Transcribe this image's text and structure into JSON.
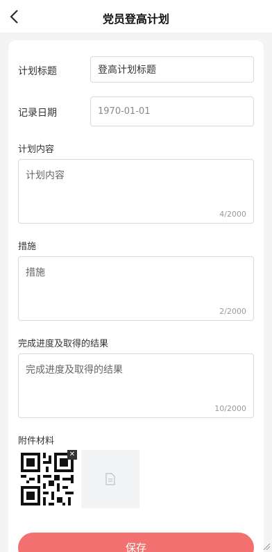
{
  "header": {
    "title": "党员登高计划"
  },
  "form": {
    "plan_title": {
      "label": "计划标题",
      "value": "登高计划标题"
    },
    "record_date": {
      "label": "记录日期",
      "value": "1970-01-01"
    },
    "plan_content": {
      "label": "计划内容",
      "placeholder": "计划内容",
      "count": "4/2000"
    },
    "measures": {
      "label": "措施",
      "placeholder": "措施",
      "count": "2/2000"
    },
    "progress": {
      "label": "完成进度及取得的结果",
      "placeholder": "完成进度及取得的结果",
      "count": "10/2000"
    },
    "attachments": {
      "label": "附件材料",
      "delete_glyph": "✕"
    },
    "save_label": "保存"
  },
  "colors": {
    "accent": "#f37070",
    "background": "#f4f4f4"
  }
}
